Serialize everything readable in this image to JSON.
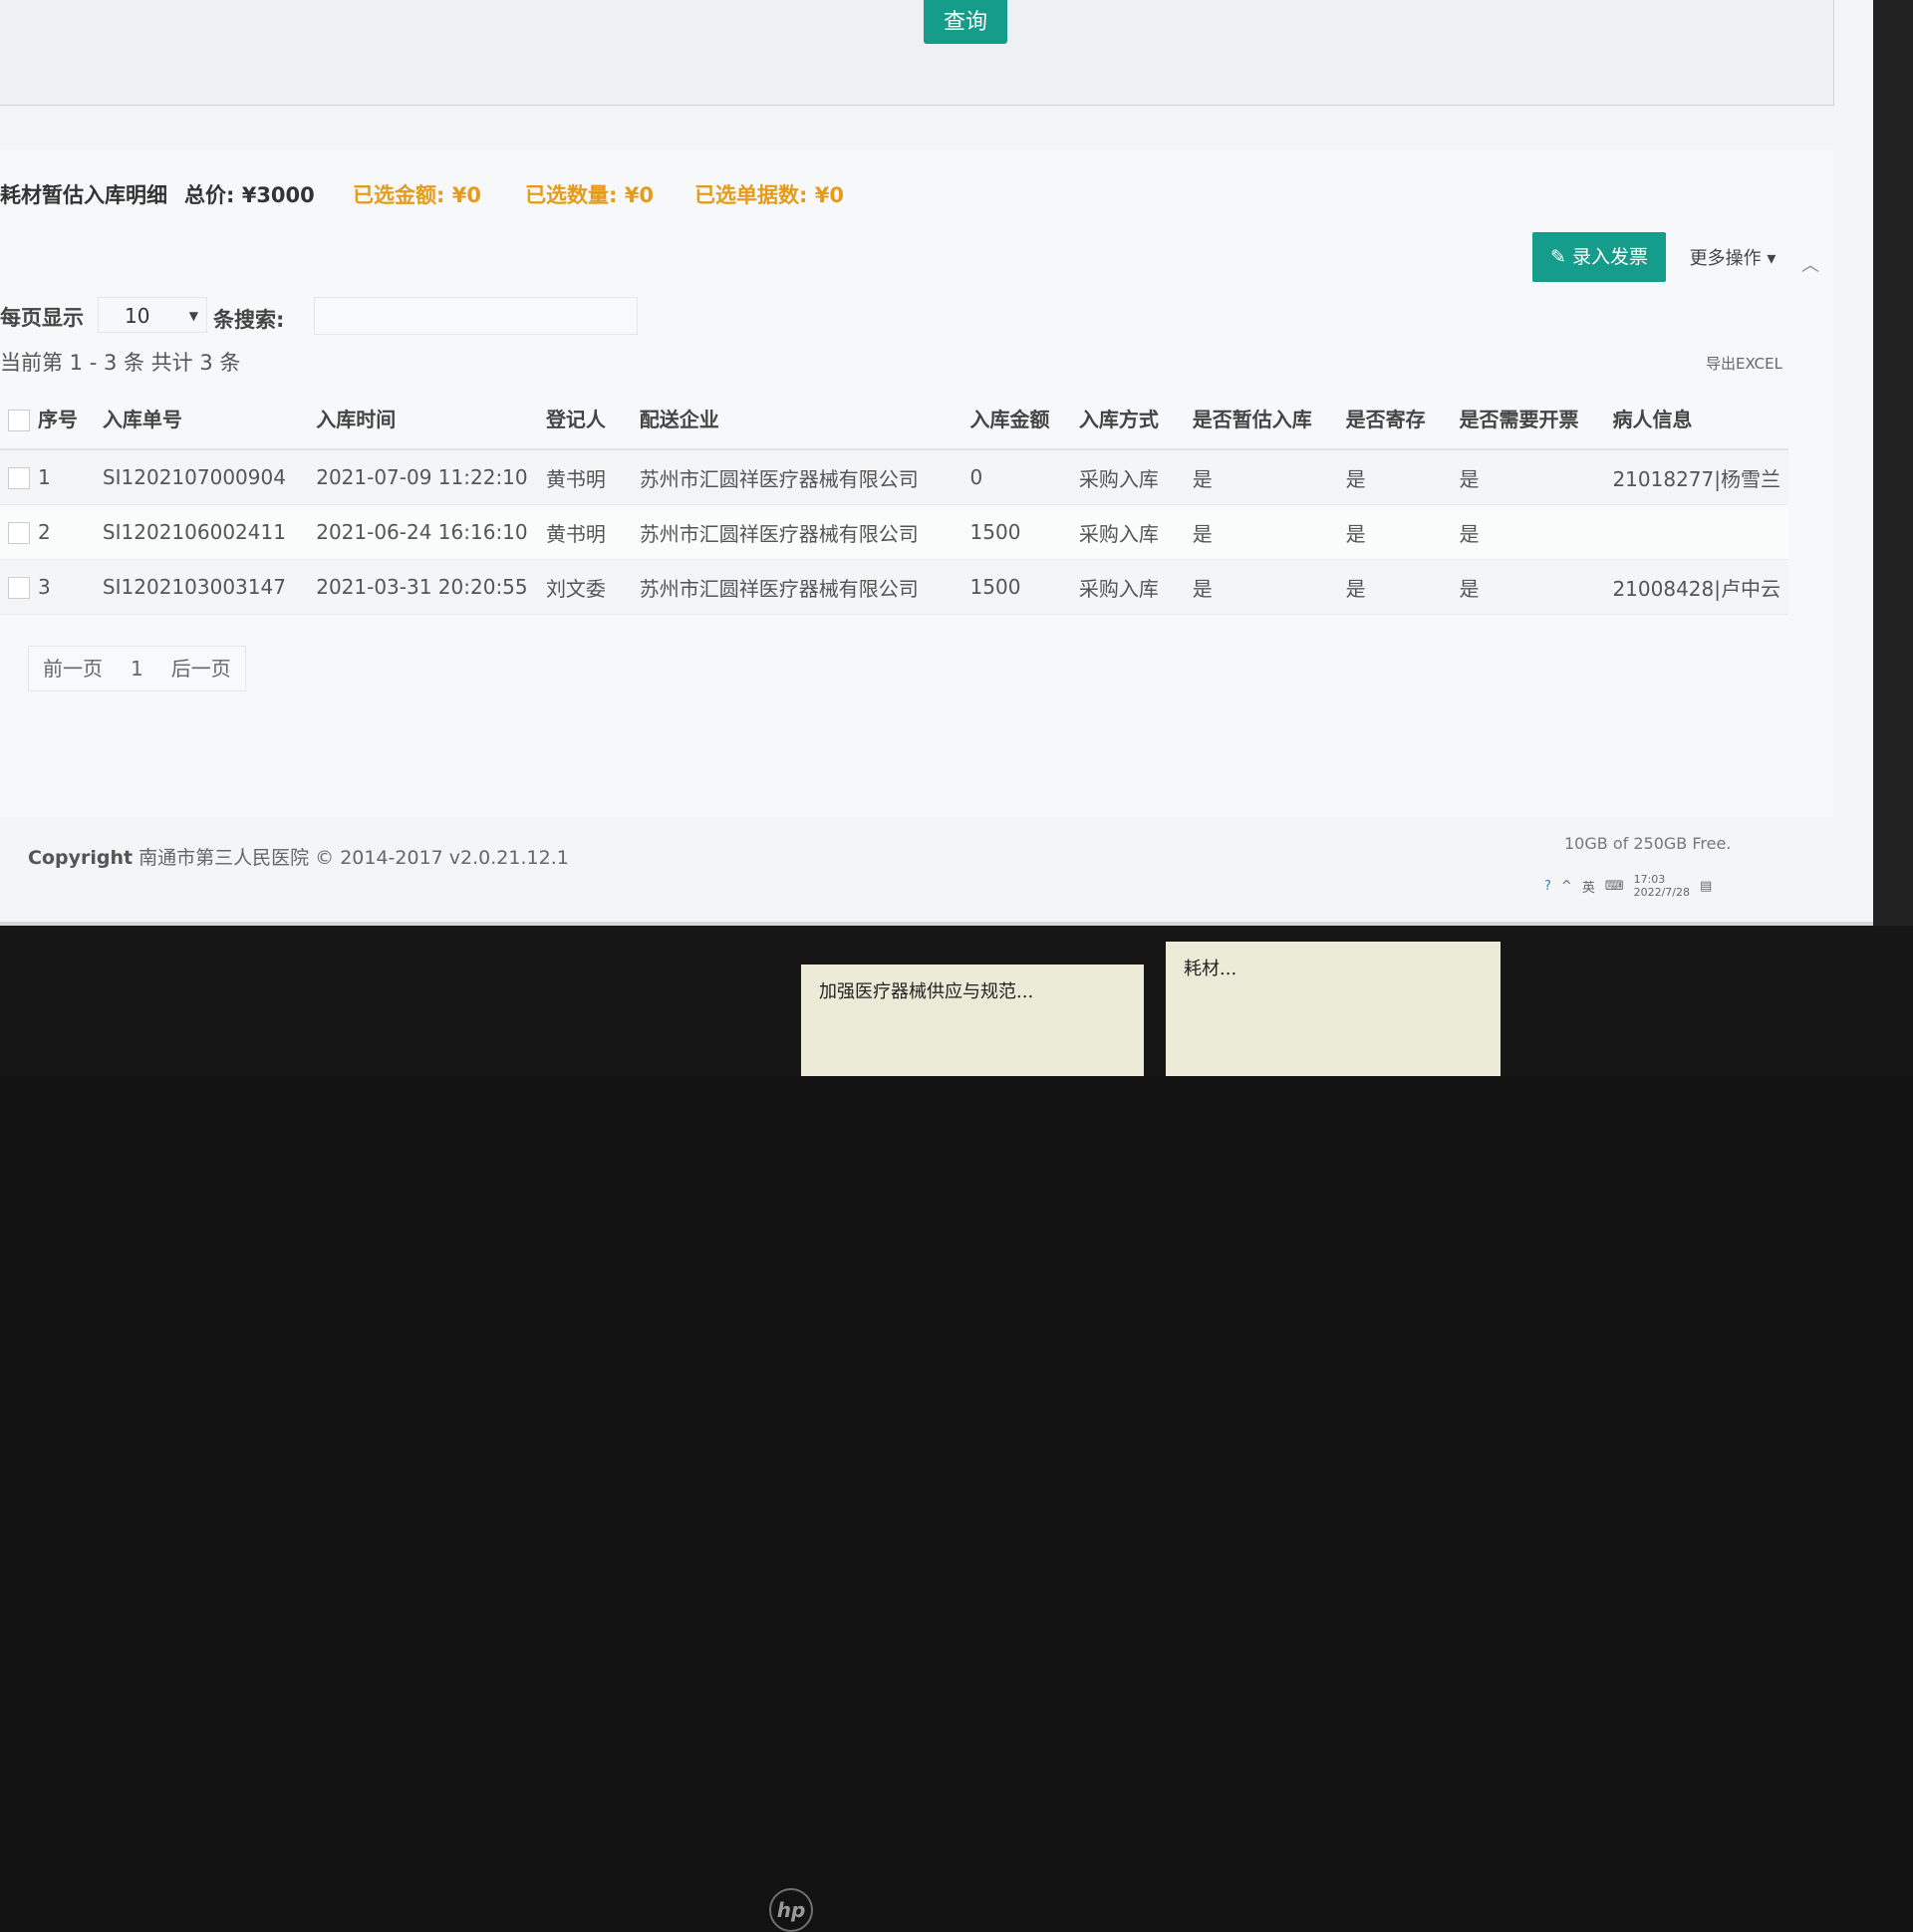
{
  "query_button": "查询",
  "summary": {
    "title": "耗材暂估入库明细",
    "total": "总价: ¥3000",
    "selected_amount": "已选金额: ¥0",
    "selected_count": "已选数量: ¥0",
    "selected_docs": "已选单据数: ¥0"
  },
  "toolbar": {
    "invoice_button": "录入发票",
    "more_button": "更多操作",
    "export": "导出EXCEL"
  },
  "list_controls": {
    "page_size_label": "每页显示",
    "page_size_value": "10",
    "search_label": "条搜索:",
    "search_placeholder": "",
    "range_info": "当前第 1 - 3 条   共计 3 条"
  },
  "table": {
    "headers": [
      "序号",
      "入库单号",
      "入库时间",
      "登记人",
      "配送企业",
      "入库金额",
      "入库方式",
      "是否暂估入库",
      "是否寄存",
      "是否需要开票",
      "病人信息"
    ],
    "rows": [
      {
        "no": "1",
        "doc": "SI1202107000904",
        "time": "2021-07-09 11:22:10",
        "registrar": "黄书明",
        "company": "苏州市汇圆祥医疗器械有限公司",
        "amount": "0",
        "method": "采购入库",
        "estimated": "是",
        "deposit": "是",
        "invoice": "是",
        "patient": "21018277|杨雪兰"
      },
      {
        "no": "2",
        "doc": "SI1202106002411",
        "time": "2021-06-24 16:16:10",
        "registrar": "黄书明",
        "company": "苏州市汇圆祥医疗器械有限公司",
        "amount": "1500",
        "method": "采购入库",
        "estimated": "是",
        "deposit": "是",
        "invoice": "是",
        "patient": ""
      },
      {
        "no": "3",
        "doc": "SI1202103003147",
        "time": "2021-03-31 20:20:55",
        "registrar": "刘文委",
        "company": "苏州市汇圆祥医疗器械有限公司",
        "amount": "1500",
        "method": "采购入库",
        "estimated": "是",
        "deposit": "是",
        "invoice": "是",
        "patient": "21008428|卢中云"
      }
    ]
  },
  "pager": {
    "prev": "前一页",
    "page": "1",
    "next": "后一页"
  },
  "footer": {
    "copyright_label": "Copyright",
    "copyright_text": "南通市第三人民医院 © 2014-2017 v2.0.21.12.1",
    "disk": "10GB of 250GB Free."
  },
  "tray": {
    "lang": "英",
    "time": "17:03",
    "date": "2022/7/28"
  },
  "notes": {
    "note1": "加强医疗器械供应与规范...",
    "note2": "耗材..."
  }
}
